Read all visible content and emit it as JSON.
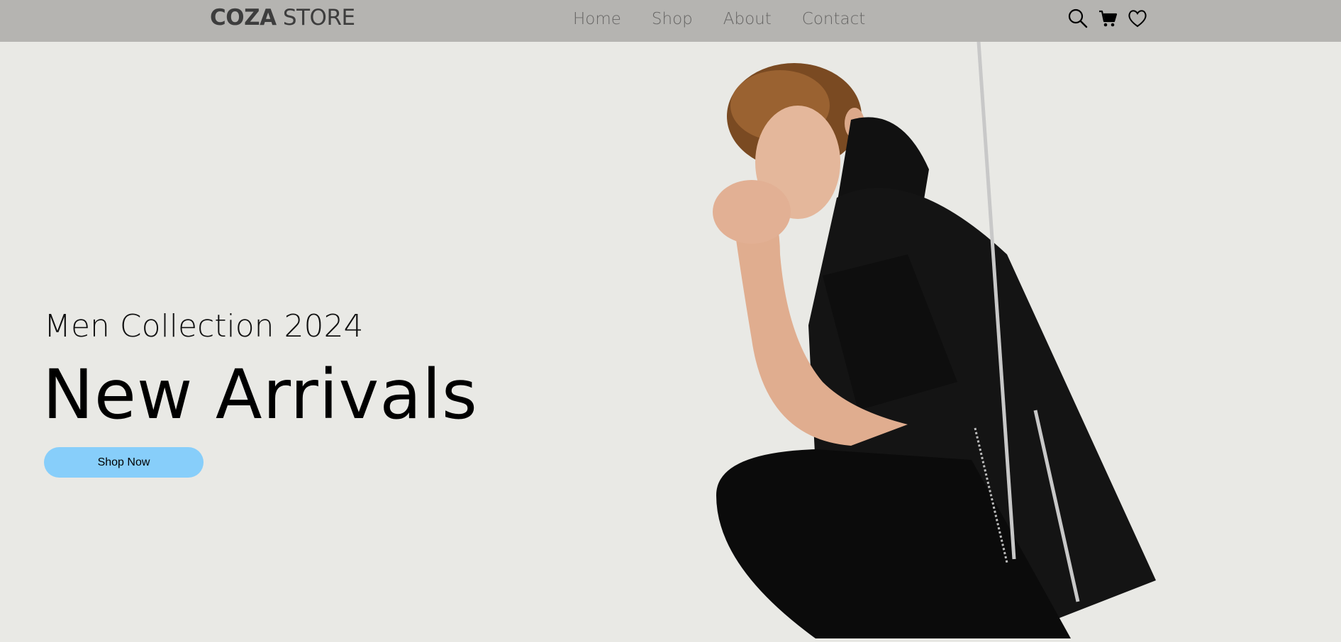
{
  "header": {
    "logo_bold": "COZA",
    "logo_light": " STORE",
    "nav": [
      {
        "label": "Home"
      },
      {
        "label": "Shop"
      },
      {
        "label": "About"
      },
      {
        "label": "Contact"
      }
    ],
    "icons": [
      "search-icon",
      "cart-icon",
      "heart-icon"
    ]
  },
  "hero": {
    "subtitle": "Men Collection 2024",
    "headline": "New Arrivals",
    "cta_label": "Shop Now",
    "image_description_icon": "model-photo"
  },
  "colors": {
    "navbar_bg": "#b5b4b1",
    "page_bg": "#e9e9e5",
    "button_bg": "#87cefa"
  }
}
